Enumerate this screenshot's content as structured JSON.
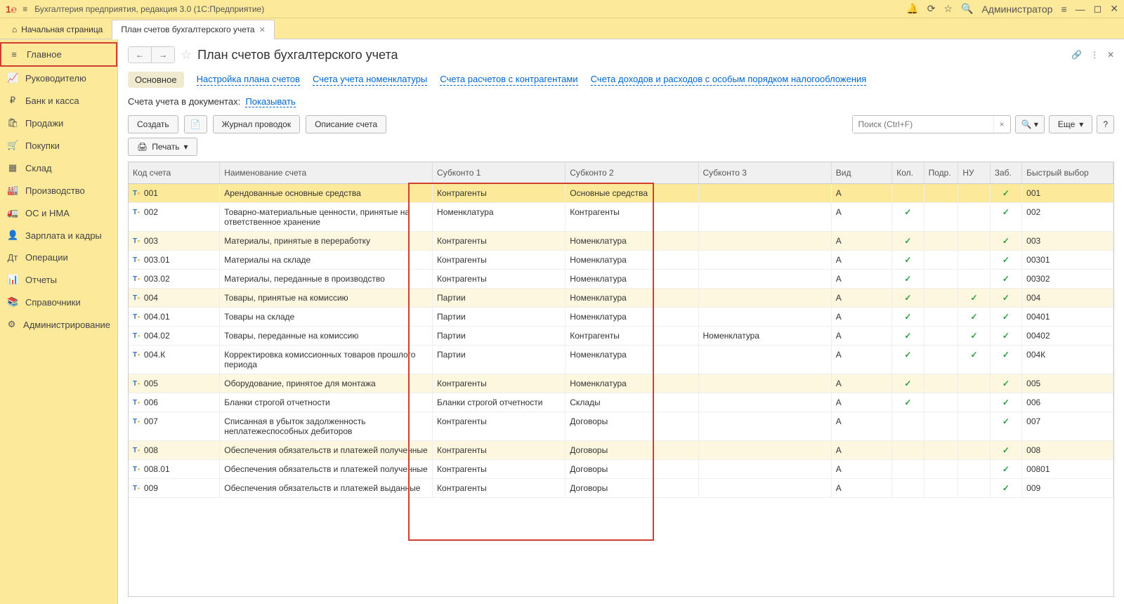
{
  "titlebar": {
    "app_title": "Бухгалтерия предприятия, редакция 3.0  (1С:Предприятие)",
    "user": "Администратор"
  },
  "tabs": {
    "home": "Начальная страница",
    "active": "План счетов бухгалтерского учета"
  },
  "sidebar": [
    {
      "icon": "≡",
      "label": "Главное",
      "selected": true
    },
    {
      "icon": "📈",
      "label": "Руководителю"
    },
    {
      "icon": "₽",
      "label": "Банк и касса"
    },
    {
      "icon": "🛍",
      "label": "Продажи"
    },
    {
      "icon": "🛒",
      "label": "Покупки"
    },
    {
      "icon": "▦",
      "label": "Склад"
    },
    {
      "icon": "🏭",
      "label": "Производство"
    },
    {
      "icon": "🚛",
      "label": "ОС и НМА"
    },
    {
      "icon": "👤",
      "label": "Зарплата и кадры"
    },
    {
      "icon": "Дт",
      "label": "Операции"
    },
    {
      "icon": "📊",
      "label": "Отчеты"
    },
    {
      "icon": "📚",
      "label": "Справочники"
    },
    {
      "icon": "⚙",
      "label": "Администрирование"
    }
  ],
  "page": {
    "title": "План счетов бухгалтерского учета"
  },
  "subtabs": [
    {
      "label": "Основное",
      "active": true
    },
    {
      "label": "Настройка плана счетов"
    },
    {
      "label": "Счета учета номенклатуры"
    },
    {
      "label": "Счета расчетов с контрагентами"
    },
    {
      "label": "Счета доходов и расходов с особым порядком налогообложения"
    }
  ],
  "doc_hint": {
    "prefix": "Счета учета в документах:",
    "link": "Показывать"
  },
  "toolbar": {
    "create": "Создать",
    "journal": "Журнал проводок",
    "describe": "Описание счета",
    "print": "Печать",
    "search_placeholder": "Поиск (Ctrl+F)",
    "more": "Еще",
    "help": "?"
  },
  "columns": {
    "code": "Код счета",
    "name": "Наименование счета",
    "sub1": "Субконто 1",
    "sub2": "Субконто 2",
    "sub3": "Субконто 3",
    "vid": "Вид",
    "kol": "Кол.",
    "podr": "Подр.",
    "nu": "НУ",
    "zab": "Заб.",
    "fast": "Быстрый выбор"
  },
  "rows": [
    {
      "code": "001",
      "name": "Арендованные основные средства",
      "s1": "Контрагенты",
      "s2": "Основные средства",
      "s3": "",
      "vid": "А",
      "kol": "",
      "podr": "",
      "nu": "",
      "zab": "✓",
      "fast": "001",
      "sel": true
    },
    {
      "code": "002",
      "name": "Товарно-материальные ценности, принятые на ответственное хранение",
      "s1": "Номенклатура",
      "s2": "Контрагенты",
      "s3": "",
      "vid": "А",
      "kol": "✓",
      "podr": "",
      "nu": "",
      "zab": "✓",
      "fast": "002"
    },
    {
      "code": "003",
      "name": "Материалы, принятые в переработку",
      "s1": "Контрагенты",
      "s2": "Номенклатура",
      "s3": "",
      "vid": "А",
      "kol": "✓",
      "podr": "",
      "nu": "",
      "zab": "✓",
      "fast": "003",
      "striped": true
    },
    {
      "code": "003.01",
      "name": "Материалы на складе",
      "s1": "Контрагенты",
      "s2": "Номенклатура",
      "s3": "",
      "vid": "А",
      "kol": "✓",
      "podr": "",
      "nu": "",
      "zab": "✓",
      "fast": "00301"
    },
    {
      "code": "003.02",
      "name": "Материалы, переданные в производство",
      "s1": "Контрагенты",
      "s2": "Номенклатура",
      "s3": "",
      "vid": "А",
      "kol": "✓",
      "podr": "",
      "nu": "",
      "zab": "✓",
      "fast": "00302"
    },
    {
      "code": "004",
      "name": "Товары, принятые на комиссию",
      "s1": "Партии",
      "s2": "Номенклатура",
      "s3": "",
      "vid": "А",
      "kol": "✓",
      "podr": "",
      "nu": "✓",
      "zab": "✓",
      "fast": "004",
      "striped": true
    },
    {
      "code": "004.01",
      "name": "Товары на складе",
      "s1": "Партии",
      "s2": "Номенклатура",
      "s3": "",
      "vid": "А",
      "kol": "✓",
      "podr": "",
      "nu": "✓",
      "zab": "✓",
      "fast": "00401"
    },
    {
      "code": "004.02",
      "name": "Товары, переданные на комиссию",
      "s1": "Партии",
      "s2": "Контрагенты",
      "s3": "Номенклатура",
      "vid": "А",
      "kol": "✓",
      "podr": "",
      "nu": "✓",
      "zab": "✓",
      "fast": "00402"
    },
    {
      "code": "004.К",
      "name": "Корректировка комиссионных товаров прошлого периода",
      "s1": "Партии",
      "s2": "Номенклатура",
      "s3": "",
      "vid": "А",
      "kol": "✓",
      "podr": "",
      "nu": "✓",
      "zab": "✓",
      "fast": "004К"
    },
    {
      "code": "005",
      "name": "Оборудование, принятое для монтажа",
      "s1": "Контрагенты",
      "s2": "Номенклатура",
      "s3": "",
      "vid": "А",
      "kol": "✓",
      "podr": "",
      "nu": "",
      "zab": "✓",
      "fast": "005",
      "striped": true
    },
    {
      "code": "006",
      "name": "Бланки строгой отчетности",
      "s1": "Бланки строгой отчетности",
      "s2": "Склады",
      "s3": "",
      "vid": "А",
      "kol": "✓",
      "podr": "",
      "nu": "",
      "zab": "✓",
      "fast": "006"
    },
    {
      "code": "007",
      "name": "Списанная в убыток задолженность неплатежеспособных дебиторов",
      "s1": "Контрагенты",
      "s2": "Договоры",
      "s3": "",
      "vid": "А",
      "kol": "",
      "podr": "",
      "nu": "",
      "zab": "✓",
      "fast": "007"
    },
    {
      "code": "008",
      "name": "Обеспечения обязательств и платежей полученные",
      "s1": "Контрагенты",
      "s2": "Договоры",
      "s3": "",
      "vid": "А",
      "kol": "",
      "podr": "",
      "nu": "",
      "zab": "✓",
      "fast": "008",
      "striped": true
    },
    {
      "code": "008.01",
      "name": "Обеспечения обязательств и платежей полученные",
      "s1": "Контрагенты",
      "s2": "Договоры",
      "s3": "",
      "vid": "А",
      "kol": "",
      "podr": "",
      "nu": "",
      "zab": "✓",
      "fast": "00801"
    },
    {
      "code": "009",
      "name": "Обеспечения обязательств и платежей выданные",
      "s1": "Контрагенты",
      "s2": "Договоры",
      "s3": "",
      "vid": "А",
      "kol": "",
      "podr": "",
      "nu": "",
      "zab": "✓",
      "fast": "009"
    }
  ]
}
